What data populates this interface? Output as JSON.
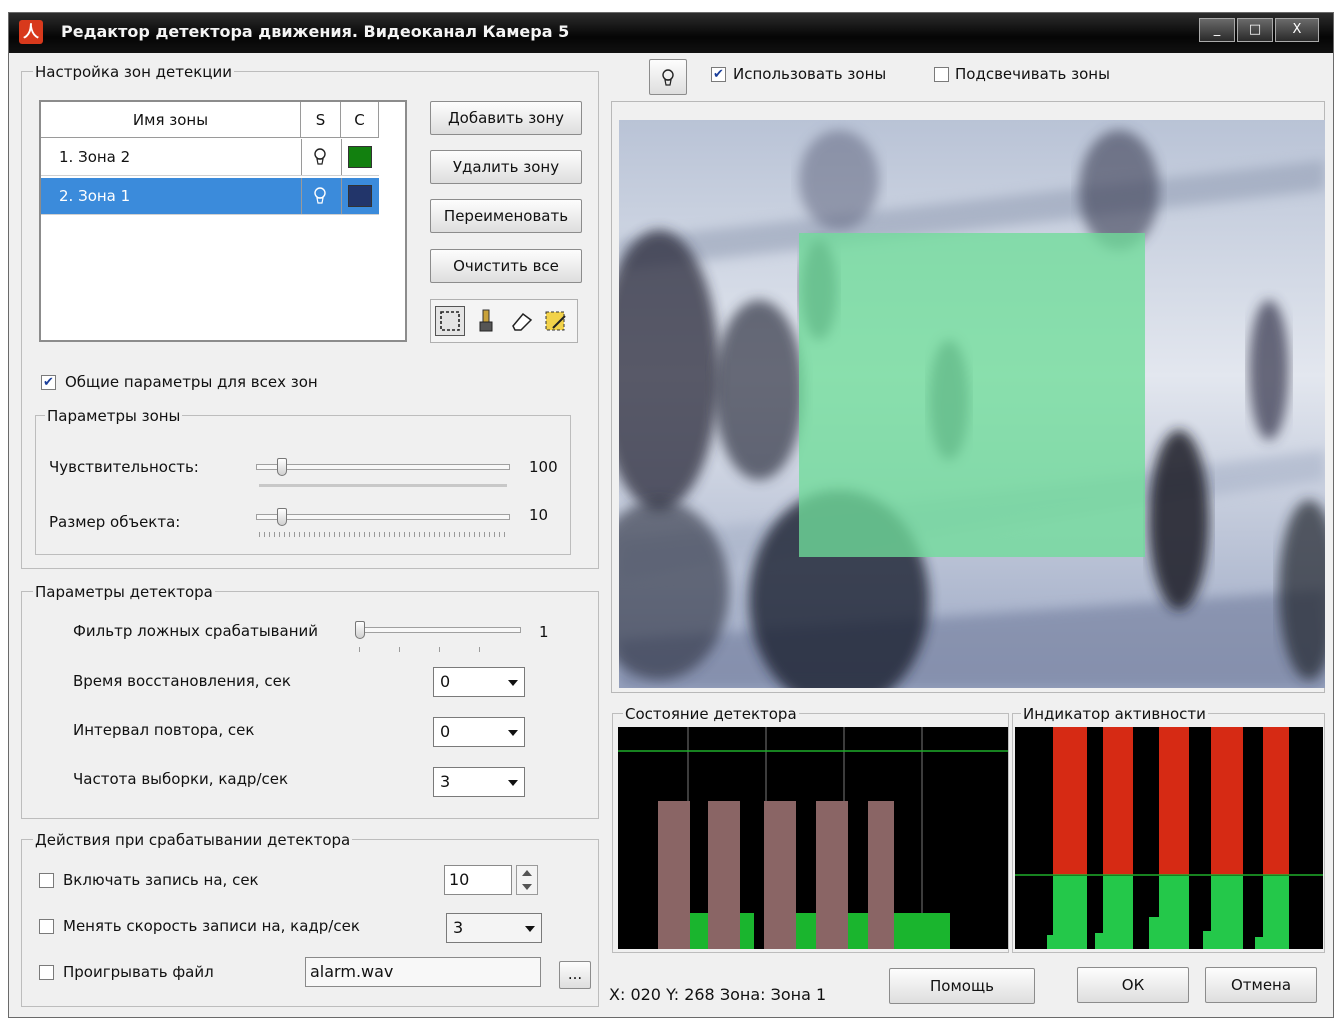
{
  "window": {
    "title": "Редактор детектора движения. Видеоканал Камера 5",
    "min_label": "_",
    "max_label": "□",
    "close_label": "X"
  },
  "zones": {
    "group_title": "Настройка зон детекции",
    "columns": {
      "name": "Имя зоны",
      "s": "S",
      "c": "C"
    },
    "rows": [
      {
        "name": "1. Зона 2",
        "s_icon": "lightbulb-icon",
        "color": "#12800f",
        "selected": false
      },
      {
        "name": "2. Зона 1",
        "s_icon": "lightbulb-icon",
        "color": "#22356a",
        "selected": true
      }
    ],
    "add_button": "Добавить зону",
    "delete_button": "Удалить зону",
    "rename_button": "Переименовать",
    "clear_button": "Очистить все",
    "tools": [
      "rect-select-icon",
      "brush-icon",
      "eraser-icon",
      "fill-icon"
    ]
  },
  "common_params": {
    "label": "Общие параметры для всех зон",
    "checked": true
  },
  "zone_params": {
    "title": "Параметры зоны",
    "sensitivity_label": "Чувствительность:",
    "sensitivity_value": "100",
    "object_size_label": "Размер объекта:",
    "object_size_value": "10"
  },
  "detector": {
    "title": "Параметры детектора",
    "filter_label": "Фильтр ложных срабатываний",
    "filter_value": "1",
    "recovery_label": "Время восстановления, сек",
    "recovery_value": "0",
    "repeat_label": "Интервал повтора, сек",
    "repeat_value": "0",
    "fps_label": "Частота выборки, кадр/сек",
    "fps_value": "3"
  },
  "actions": {
    "title": "Действия при срабатывании детектора",
    "record_label": "Включать запись на, сек",
    "record_value": "10",
    "speed_label": "Менять скорость записи на, кадр/сек",
    "speed_value": "3",
    "play_label": "Проигрывать файл",
    "play_file": "alarm.wav",
    "browse_label": "..."
  },
  "view": {
    "use_zones_label": "Использовать зоны",
    "use_zones_checked": true,
    "highlight_zones_label": "Подсвечивать зоны",
    "highlight_zones_checked": false
  },
  "state_panel": {
    "title": "Состояние детектора"
  },
  "activity_panel": {
    "title": "Индикатор активности"
  },
  "status": {
    "text": "X: 020  Y: 268 Зона: Зона 1"
  },
  "buttons": {
    "help": "Помощь",
    "ok": "ОК",
    "cancel": "Отмена"
  },
  "colors": {
    "zone_overlay": "#6fdc9a",
    "detector_bar": "#8a6565",
    "detector_green": "#1ab52e",
    "activity_red": "#d62a14",
    "activity_green": "#24c84a",
    "threshold_line": "#1fae2a"
  }
}
